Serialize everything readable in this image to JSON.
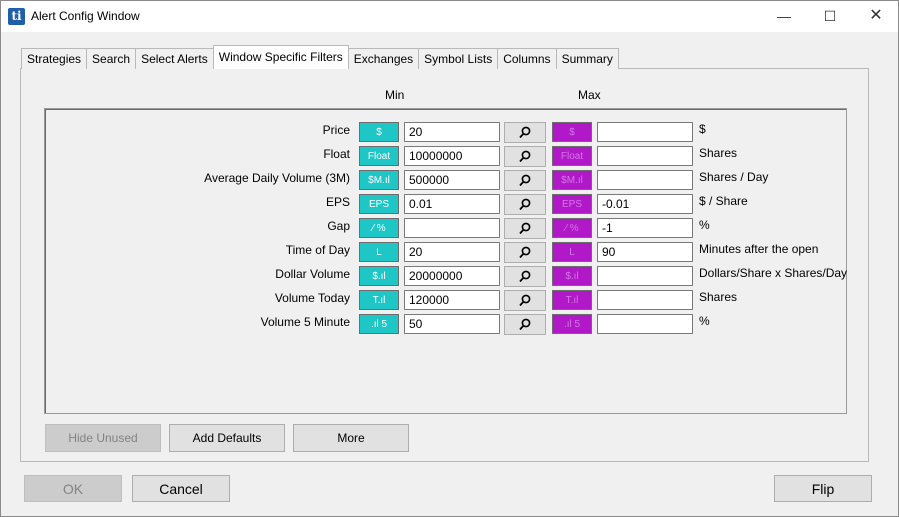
{
  "window": {
    "title": "Alert Config Window",
    "app_icon_text": "ti",
    "minimize_glyph": "—",
    "maximize_glyph": "☐",
    "close_glyph": "✕"
  },
  "tabs": [
    {
      "label": "Strategies"
    },
    {
      "label": "Search"
    },
    {
      "label": "Select Alerts"
    },
    {
      "label": "Window Specific Filters",
      "active": true
    },
    {
      "label": "Exchanges"
    },
    {
      "label": "Symbol Lists"
    },
    {
      "label": "Columns"
    },
    {
      "label": "Summary"
    }
  ],
  "columns": {
    "min": "Min",
    "max": "Max"
  },
  "filters": [
    {
      "label": "Price",
      "icon": "$",
      "min": "20",
      "max": "",
      "unit": "$"
    },
    {
      "label": "Float",
      "icon": "Float",
      "min": "10000000",
      "max": "",
      "unit": "Shares"
    },
    {
      "label": "Average Daily Volume (3M)",
      "icon": "$M.ıl",
      "min": "500000",
      "max": "",
      "unit": "Shares / Day"
    },
    {
      "label": "EPS",
      "icon": "EPS",
      "min": "0.01",
      "max": "-0.01",
      "unit": "$ / Share"
    },
    {
      "label": "Gap",
      "icon": "⁄ %",
      "min": "",
      "max": "-1",
      "unit": "%"
    },
    {
      "label": "Time of Day",
      "icon": "L",
      "min": "20",
      "max": "90",
      "unit": "Minutes after the open"
    },
    {
      "label": "Dollar Volume",
      "icon": "$.ıl",
      "min": "20000000",
      "max": "",
      "unit": "Dollars/Share x Shares/Day"
    },
    {
      "label": "Volume Today",
      "icon": "T.ıl",
      "min": "120000",
      "max": "",
      "unit": "Shares"
    },
    {
      "label": "Volume 5 Minute",
      "icon": ".ıl 5",
      "min": "50",
      "max": "",
      "unit": "%"
    }
  ],
  "buttons": {
    "hide_unused": "Hide Unused",
    "add_defaults": "Add Defaults",
    "more": "More",
    "ok": "OK",
    "cancel": "Cancel",
    "flip": "Flip"
  },
  "colors": {
    "min_accent": "#1ec6c6",
    "max_accent": "#b018c8"
  }
}
